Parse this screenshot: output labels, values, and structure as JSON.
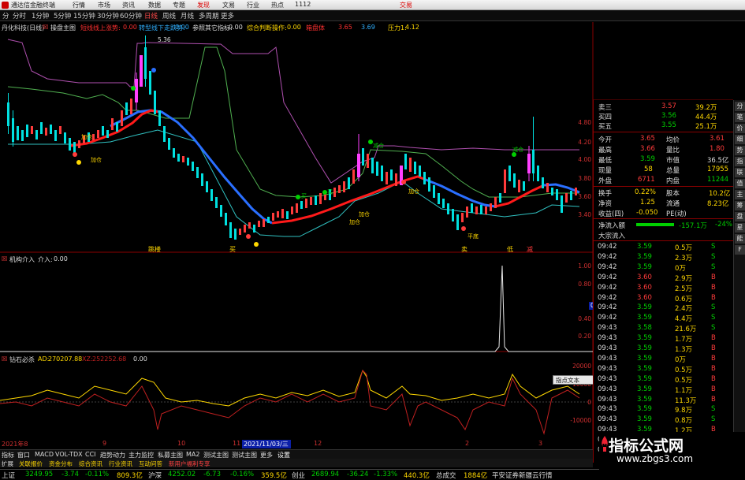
{
  "titlebar": {
    "app_name": "通达信金融终端",
    "menus": [
      "行情",
      "市场",
      "资讯",
      "数据",
      "专题",
      "发现",
      "文易",
      "行业",
      "热点"
    ],
    "version": "1112",
    "right_link": "交易"
  },
  "toolbar": {
    "periods": [
      "分",
      "分时",
      "1分钟",
      "5分钟",
      "15分钟",
      "30分钟",
      "60分钟",
      "日线",
      "周线",
      "月线",
      "多周期",
      "更多"
    ],
    "active_period": "日线"
  },
  "main_header": {
    "stock": "丹化科技(日线)",
    "indicator": "操盘主图",
    "v1_label": "短线线上涨势:",
    "v1": "0.00",
    "v2_label": "转型线下走跌势:",
    "v2": "0.00",
    "v3_label": "参照其它指标:",
    "v3": "0.00",
    "v4_label": "综合判断操作:",
    "v4": "0.00",
    "v5_label": "箱盘体",
    "v5": "3.65",
    "v6": "3.69",
    "v7_label": "压力1:",
    "v7": "4.12",
    "peak_label": "5.36"
  },
  "main_chart": {
    "price_axis": [
      "4.80",
      "4.40",
      "4.20",
      "4.00",
      "3.80",
      "3.60",
      "3.40"
    ],
    "markers": [
      "跳楼",
      "买",
      "卖",
      "低",
      "减",
      "涨"
    ],
    "signals": [
      "加仓",
      "加仓",
      "加仓",
      "减仓",
      "加仓",
      "加仓",
      "加仓",
      "买",
      "买",
      "平底",
      "加仓",
      "减仓",
      "卖"
    ]
  },
  "panel2": {
    "name": "机构介入",
    "label": "介入:",
    "value": "0.00",
    "axis": [
      "1.00",
      "0.80",
      "0.60",
      "0.40",
      "0.20"
    ],
    "flag_value": "0.48"
  },
  "panel3": {
    "name": "钻石必杀",
    "ad_label": "AD:",
    "ad": "270207.88",
    "xz_label": "XZ:",
    "xz": "252252.68",
    "v3": "0.00",
    "axis": [
      "20000",
      "10000",
      "0",
      "-10000"
    ],
    "popup_label": "指点文本"
  },
  "date_axis": {
    "labels": [
      "2021年8",
      "9",
      "10",
      "11",
      "2021/11/03/三",
      "12",
      "2",
      "3"
    ],
    "selected": "2021/11/03/三"
  },
  "bottom_tabs": {
    "row1": [
      "指标",
      "窗口",
      "MACD",
      "VOL-TDX",
      "CCI",
      "趋势动力",
      "主力监控",
      "私募主图",
      "MA2",
      "测试主图",
      "测试主图",
      "更多",
      "设置"
    ],
    "row2": [
      "扩展",
      "关联报价",
      "资金分布",
      "综合资讯",
      "行业资讯",
      "互动问答",
      "新用户福利专享"
    ]
  },
  "quote": {
    "asks": [
      {
        "label": "卖三",
        "price": "3.57",
        "vol": "39.2万"
      },
      {
        "label": "买四",
        "price": "3.56",
        "vol": "44.4万"
      },
      {
        "label": "买五",
        "price": "3.55",
        "vol": "25.1万"
      }
    ],
    "stats": [
      {
        "l1": "今开",
        "v1": "3.65",
        "l2": "均价",
        "v2": "3.61"
      },
      {
        "l1": "最高",
        "v1": "3.66",
        "l2": "量比",
        "v2": "1.80"
      },
      {
        "l1": "最低",
        "v1": "3.59",
        "l2": "市值",
        "v2": "36.5亿"
      },
      {
        "l1": "现量",
        "v1": "58",
        "l2": "总量",
        "v2": "17955"
      },
      {
        "l1": "外盘",
        "v1": "6711",
        "l2": "内盘",
        "v2": "11244"
      },
      {
        "l1": "换手",
        "v1": "0.22%",
        "l2": "股本",
        "v2": "10.2亿"
      },
      {
        "l1": "净资",
        "v1": "1.25",
        "l2": "流通",
        "v2": "8.23亿"
      },
      {
        "l1": "收益(四)",
        "v1": "-0.050",
        "l2": "PE(动)",
        "v2": ""
      }
    ],
    "flow": [
      {
        "label": "净流入额",
        "value": "-157.1万",
        "pct": "-24%"
      },
      {
        "label": "大宗流入",
        "value": "",
        "pct": ""
      }
    ]
  },
  "ticks": [
    {
      "t": "09:42",
      "p": "3.59",
      "v": "0.5万",
      "s": "S"
    },
    {
      "t": "09:42",
      "p": "3.59",
      "v": "2.3万",
      "s": "S"
    },
    {
      "t": "09:42",
      "p": "3.59",
      "v": "0万",
      "s": "S"
    },
    {
      "t": "09:42",
      "p": "3.60",
      "v": "2.9万",
      "s": "B"
    },
    {
      "t": "09:42",
      "p": "3.60",
      "v": "2.5万",
      "s": "B"
    },
    {
      "t": "09:42",
      "p": "3.60",
      "v": "0.6万",
      "s": "B"
    },
    {
      "t": "09:42",
      "p": "3.59",
      "v": "2.4万",
      "s": "S"
    },
    {
      "t": "09:42",
      "p": "3.59",
      "v": "4.4万",
      "s": "S"
    },
    {
      "t": "09:43",
      "p": "3.58",
      "v": "21.6万",
      "s": "S"
    },
    {
      "t": "09:43",
      "p": "3.59",
      "v": "1.7万",
      "s": "B"
    },
    {
      "t": "09:43",
      "p": "3.59",
      "v": "1.3万",
      "s": "B"
    },
    {
      "t": "09:43",
      "p": "3.59",
      "v": "0万",
      "s": "B"
    },
    {
      "t": "09:43",
      "p": "3.59",
      "v": "0.5万",
      "s": "B"
    },
    {
      "t": "09:43",
      "p": "3.59",
      "v": "0.5万",
      "s": "B"
    },
    {
      "t": "09:43",
      "p": "3.59",
      "v": "1.1万",
      "s": "B"
    },
    {
      "t": "09:43",
      "p": "3.59",
      "v": "11.3万",
      "s": "B"
    },
    {
      "t": "09:43",
      "p": "3.59",
      "v": "9.8万",
      "s": "S"
    },
    {
      "t": "09:43",
      "p": "3.59",
      "v": "0.8万",
      "s": "S"
    },
    {
      "t": "09:43",
      "p": "3.59",
      "v": "1.2万",
      "s": "B"
    },
    {
      "t": "09:43",
      "p": "3.59",
      "v": "1.4万",
      "s": "B"
    },
    {
      "t": "09:43",
      "p": "3.59",
      "v": "0.2万",
      "s": "B"
    }
  ],
  "sidebar": [
    "分",
    "笔",
    "价",
    "细",
    "势",
    "指",
    "联",
    "值",
    "主",
    "筹",
    "盘",
    "星",
    "能",
    "F"
  ],
  "statusbar": {
    "sh_label": "上证",
    "sh": "3249.95",
    "sh_chg": "-3.74",
    "sh_pct": "-0.11%",
    "sh_amt": "809.3亿",
    "sz_label": "沪深",
    "sz": "4252.02",
    "sz_chg": "-6.73",
    "sz_pct": "-0.16%",
    "sz_amt": "359.5亿",
    "cy_label": "创业",
    "cy": "2689.94",
    "cy_chg": "-36.24",
    "cy_pct": "-1.33%",
    "cy_amt": "440.3亿",
    "total_label": "总成交",
    "total": "1884亿",
    "broker": "平安证券新疆云行情"
  },
  "watermark": {
    "line1": "指标公式网",
    "line2": "www.zbgs3.com"
  },
  "colors": {
    "up": "#ff3b3b",
    "down": "#00e0e0",
    "ma_blue": "#2a6fff",
    "ma_red": "#ff1a1a",
    "yellow": "#ffd800",
    "green": "#00d000",
    "magenta": "#ff40ff"
  }
}
